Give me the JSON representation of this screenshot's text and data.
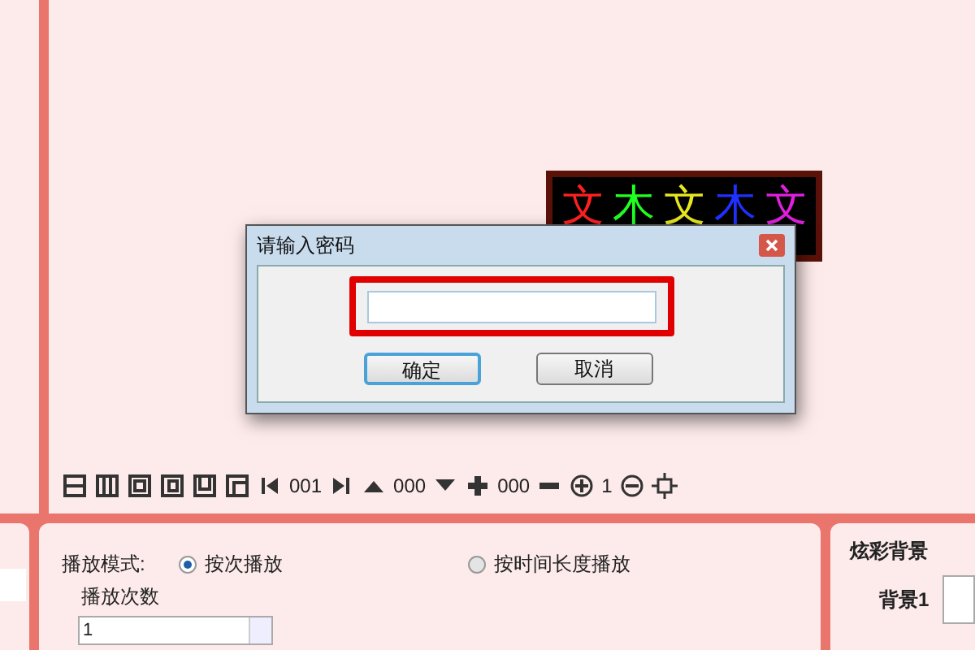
{
  "preview": {
    "chars": [
      {
        "text": "文",
        "color": "#ff2020"
      },
      {
        "text": "木",
        "color": "#20ff20"
      },
      {
        "text": "文",
        "color": "#e8e820"
      },
      {
        "text": "木",
        "color": "#2030ff"
      },
      {
        "text": "文",
        "color": "#e020e0"
      }
    ]
  },
  "toolbar": {
    "counter": "001",
    "vertical": "000",
    "size": "000",
    "zoom": "1"
  },
  "dialog": {
    "title": "请输入密码",
    "buttons": [
      {
        "label": "确定",
        "selected": true
      },
      {
        "label": "取消",
        "selected": false
      }
    ]
  },
  "playback": {
    "label": "播放模式:",
    "options": [
      {
        "label": "按次播放",
        "selected": true
      },
      {
        "label": "按时间长度播放",
        "selected": false
      }
    ],
    "count_label": "播放次数",
    "count_value": "1"
  },
  "background_panel": {
    "title": "炫彩背景",
    "item_label": "背景1"
  }
}
